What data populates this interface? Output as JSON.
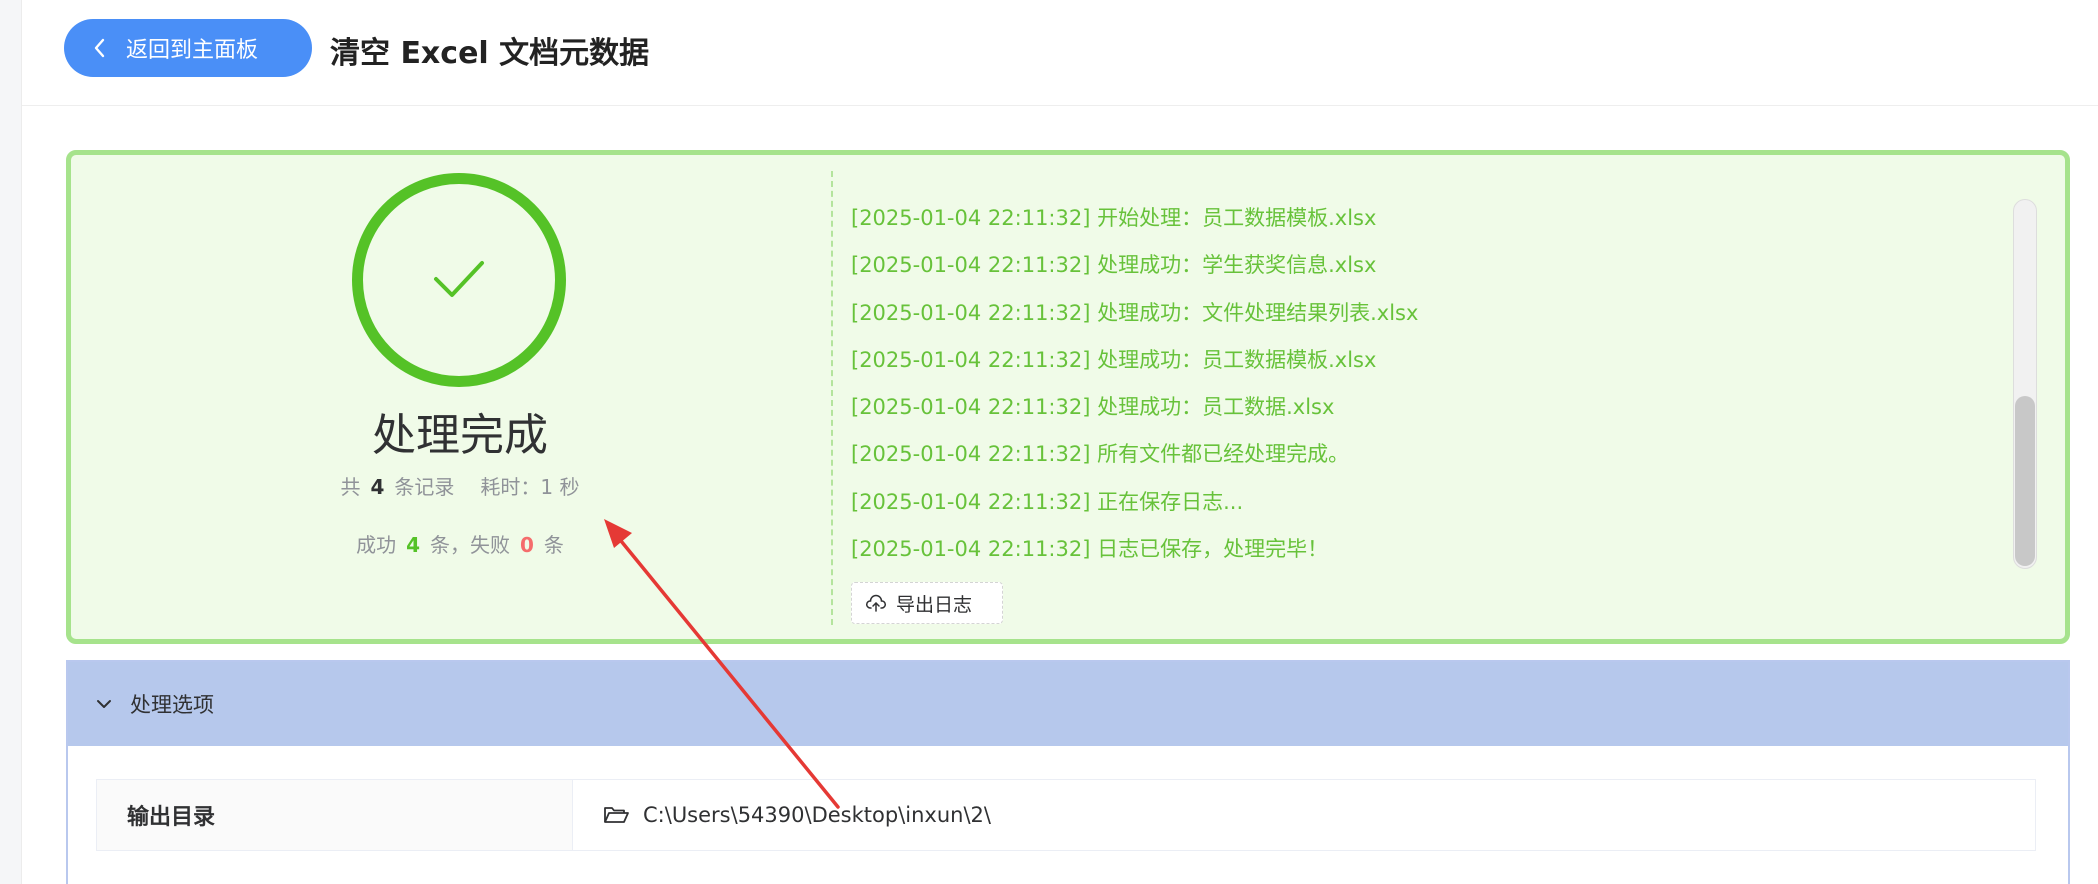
{
  "header": {
    "back_label": "返回到主面板",
    "title": "清空 Excel 文档元数据"
  },
  "result": {
    "status": "处理完成",
    "summary": {
      "prefix": "共",
      "total": "4",
      "suffix": "条记录",
      "time_label": "耗时：1 秒"
    },
    "counts": {
      "success_prefix": "成功",
      "success": "4",
      "success_suffix": "条，失败",
      "fail": "0",
      "fail_suffix": "条"
    },
    "logs": [
      "[2025-01-04 22:11:32] 开始处理：员工数据模板.xlsx",
      "[2025-01-04 22:11:32] 处理成功：学生获奖信息.xlsx",
      "[2025-01-04 22:11:32] 处理成功：文件处理结果列表.xlsx",
      "[2025-01-04 22:11:32] 处理成功：员工数据模板.xlsx",
      "[2025-01-04 22:11:32] 处理成功：员工数据.xlsx",
      "[2025-01-04 22:11:32] 所有文件都已经处理完成。",
      "[2025-01-04 22:11:32] 正在保存日志...",
      "[2025-01-04 22:11:32] 日志已保存，处理完毕！"
    ],
    "export_label": "导出日志"
  },
  "options": {
    "title": "处理选项",
    "output_label": "输出目录",
    "output_value": "C:\\Users\\54390\\Desktop\\inxun\\2\\"
  },
  "colors": {
    "primary": "#4a8ff7",
    "success": "#55c227",
    "danger": "#f56c6c",
    "panel_bg": "#f0fbe8",
    "options_header": "#b6c8ec",
    "annotation_arrow": "#e53935"
  },
  "icons": [
    "chevron-left-icon",
    "check-icon",
    "cloud-upload-icon",
    "chevron-down-icon",
    "folder-open-icon"
  ]
}
